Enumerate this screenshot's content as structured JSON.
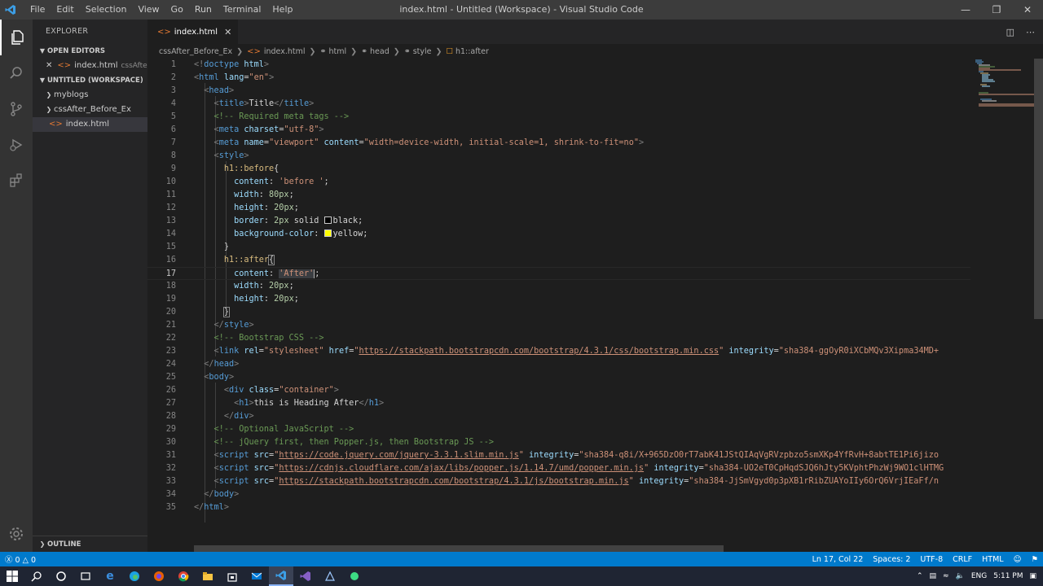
{
  "titlebar": {
    "menus": [
      "File",
      "Edit",
      "Selection",
      "View",
      "Go",
      "Run",
      "Terminal",
      "Help"
    ],
    "title": "index.html - Untitled (Workspace) - Visual Studio Code"
  },
  "sidebar": {
    "header": "EXPLORER",
    "open_editors": "OPEN EDITORS",
    "open_file": "index.html",
    "open_file_folder": "cssAfte...",
    "workspace": "UNTITLED (WORKSPACE)",
    "folders": [
      {
        "name": "myblogs"
      },
      {
        "name": "cssAfter_Before_Ex"
      }
    ],
    "file": "index.html",
    "outline": "OUTLINE"
  },
  "tab": {
    "label": "index.html"
  },
  "breadcrumb": [
    "cssAfter_Before_Ex",
    "index.html",
    "html",
    "head",
    "style",
    "h1::after"
  ],
  "status": {
    "problems_errors": "0",
    "problems_warnings": "0",
    "position": "Ln 17, Col 22",
    "spaces": "Spaces: 2",
    "encoding": "UTF-8",
    "eol": "CRLF",
    "language": "HTML"
  },
  "taskbar": {
    "lang": "ENG",
    "time": "5:11 PM"
  },
  "editor": {
    "lines": [
      "1",
      "2",
      "3",
      "4",
      "5",
      "6",
      "7",
      "8",
      "9",
      "10",
      "11",
      "12",
      "13",
      "14",
      "15",
      "16",
      "17",
      "18",
      "19",
      "20",
      "21",
      "22",
      "23",
      "24",
      "25",
      "26",
      "27",
      "28",
      "29",
      "30",
      "31",
      "32",
      "33",
      "34",
      "35"
    ]
  }
}
